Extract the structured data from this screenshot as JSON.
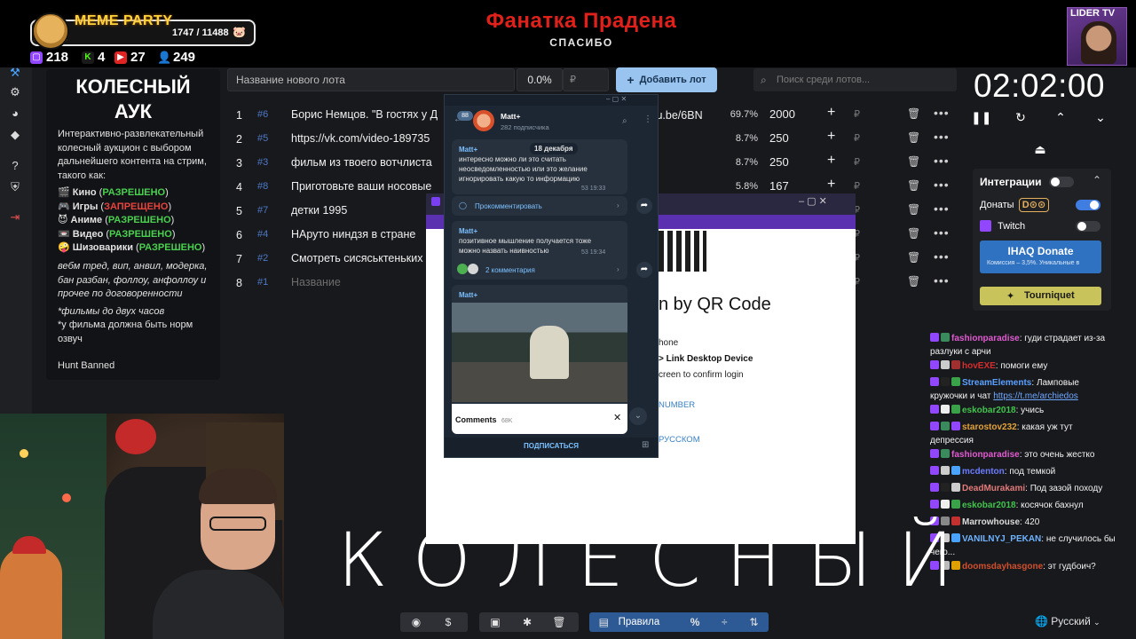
{
  "overlay": {
    "meme_party": {
      "title": "MEME PARTY",
      "count": "1747 / 11488",
      "progress": 0.152
    },
    "stats": [
      {
        "icon": "twitch-chat-icon",
        "value": "218",
        "color": "#9146ff"
      },
      {
        "icon": "kick-icon",
        "value": "4",
        "color": "#53fc18"
      },
      {
        "icon": "vk-live-icon",
        "value": "27",
        "color": "#e02424"
      },
      {
        "icon": "user-icon",
        "value": "249",
        "color": "#4aa3ff"
      }
    ],
    "title": "Фанатка Прадена",
    "subtitle": "СПАСИБО",
    "channel_badge": "LIDER TV"
  },
  "info": {
    "title": "КОЛЕСНЫЙ АУК",
    "description": "Интерактивно-развлекательный колесный аукцион с выбором дальнейшего контента на стрим, такого как:",
    "categories": [
      {
        "icon": "clapper-icon",
        "name": "Кино",
        "status": "РАЗРЕШЕНО",
        "allowed": true
      },
      {
        "icon": "gamepad-icon",
        "name": "Игры",
        "status": "ЗАПРЕЩЕНО",
        "allowed": false
      },
      {
        "icon": "anime-icon",
        "name": "Аниме",
        "status": "РАЗРЕШЕНО",
        "allowed": true
      },
      {
        "icon": "video-icon",
        "name": "Видео",
        "status": "РАЗРЕШЕНО",
        "allowed": true
      },
      {
        "icon": "crazy-icon",
        "name": "Шизоварики",
        "status": "РАЗРЕШЕНО",
        "allowed": true
      }
    ],
    "rules": "вебм тред, вип, анвил, модерка, бан разбан, фоллоу, анфоллоу и прочее по договоренности",
    "note1": "*фильмы до двух часов",
    "note2": "*у фильма должна быть норм озвуч",
    "hunt": "Hunt Banned"
  },
  "lot_form": {
    "name_placeholder": "Название нового лота",
    "percent": "0.0%",
    "currency": "₽",
    "add_button": "Добавить лот",
    "search_placeholder": "Поиск среди лотов..."
  },
  "lots": [
    {
      "num": "1",
      "id": "#6",
      "name": "Борис Немцов. \"В гостях у Д",
      "percent": "69.7%",
      "amount": "2000"
    },
    {
      "num": "2",
      "id": "#5",
      "name": "https://vk.com/video-189735",
      "percent": "8.7%",
      "amount": "250"
    },
    {
      "num": "3",
      "id": "#3",
      "name": "фильм из твоего вотчлиста",
      "percent": "8.7%",
      "amount": "250"
    },
    {
      "num": "4",
      "id": "#8",
      "name": "Приготовьте ваши носовые",
      "percent": "5.8%",
      "amount": "167"
    },
    {
      "num": "5",
      "id": "#7",
      "name": "детки 1995",
      "percent": "",
      "amount": ""
    },
    {
      "num": "6",
      "id": "#4",
      "name": "НАруто ниндзя в стране",
      "percent": "",
      "amount": ""
    },
    {
      "num": "7",
      "id": "#2",
      "name": "Смотреть сисяськтеньких",
      "percent": "",
      "amount": ""
    },
    {
      "num": "8",
      "id": "#1",
      "name": "Название",
      "percent": "",
      "amount": "",
      "placeholder": true
    }
  ],
  "lot_url_fragment": "tu.be/6BN",
  "timer": {
    "value": "02:02:00"
  },
  "integrations": {
    "title": "Интеграции",
    "donations": "Донаты",
    "donation_service": "D",
    "twitch": "Twitch",
    "ihaq_title": "IHAQ Donate",
    "ihaq_sub": "Комиссия – 3,5%. Уникальные в",
    "tourniquet": "Tourniquet"
  },
  "chat": [
    {
      "nick": "fashionparadise",
      "color": "#e05bd0",
      "text": "гуди страдает из-за разлуки с арчи"
    },
    {
      "nick": "hovEXE",
      "color": "#d62d2d",
      "text": "помоги ему"
    },
    {
      "nick": "StreamElements",
      "color": "#5aa0ff",
      "text": "Ламповые кружочки и чат",
      "link": "https://t.me/archiedos"
    },
    {
      "nick": "eskobar2018",
      "color": "#41c44d",
      "text": "учись"
    },
    {
      "nick": "starostov232",
      "color": "#e3a33a",
      "text": "какая уж тут депрессия"
    },
    {
      "nick": "fashionparadise",
      "color": "#e05bd0",
      "text": "это очень жестко"
    },
    {
      "nick": "mcdenton",
      "color": "#6c7cff",
      "text": "под темкой"
    },
    {
      "nick": "DeadMurakami",
      "color": "#e27a7a",
      "text": "Под зазой походу"
    },
    {
      "nick": "eskobar2018",
      "color": "#41c44d",
      "text": "косячок бахнул"
    },
    {
      "nick": "Marrowhouse",
      "color": "#dcdcdc",
      "text": "420"
    },
    {
      "nick": "VANILNYJ_PEKAN",
      "color": "#6fb3ff",
      "text": "не случилось бы чего..."
    },
    {
      "nick": "doomsdayhasgone",
      "color": "#d0502d",
      "text": "эт гудбоич?"
    }
  ],
  "telegram": {
    "unread": "88",
    "channel": "Matt+",
    "subscribers": "282 подписчика",
    "date": "18 декабря",
    "post1_author": "Matt+",
    "post1_text": "интересно можно ли это считать неосведомленностью или это желание игнорировать какую то информацию",
    "post1_meta": "53  19:33",
    "comment_button": "Прокомментировать",
    "post2_author": "Matt+",
    "post2_text": "позитивное мышление получается тоже можно назвать наивностью",
    "post2_meta": "53  19:34",
    "post2_comments": "2 комментария",
    "post3_author": "Matt+",
    "comments_title": "Comments",
    "comments_count": "68K",
    "subscribe": "ПОДПИСАТЬСЯ"
  },
  "qr_login": {
    "heading": "n by QR Code",
    "step1": "hone",
    "step2": "> Link Desktop Device",
    "step3": "creen to confirm login",
    "phone_link": "NUMBER",
    "lang_link": "РУССКОМ"
  },
  "overlay_word": "КОЛЕСНЫЙ",
  "bottom_bar": {
    "rules": "Правила",
    "percent": "%",
    "language": "Русский"
  }
}
